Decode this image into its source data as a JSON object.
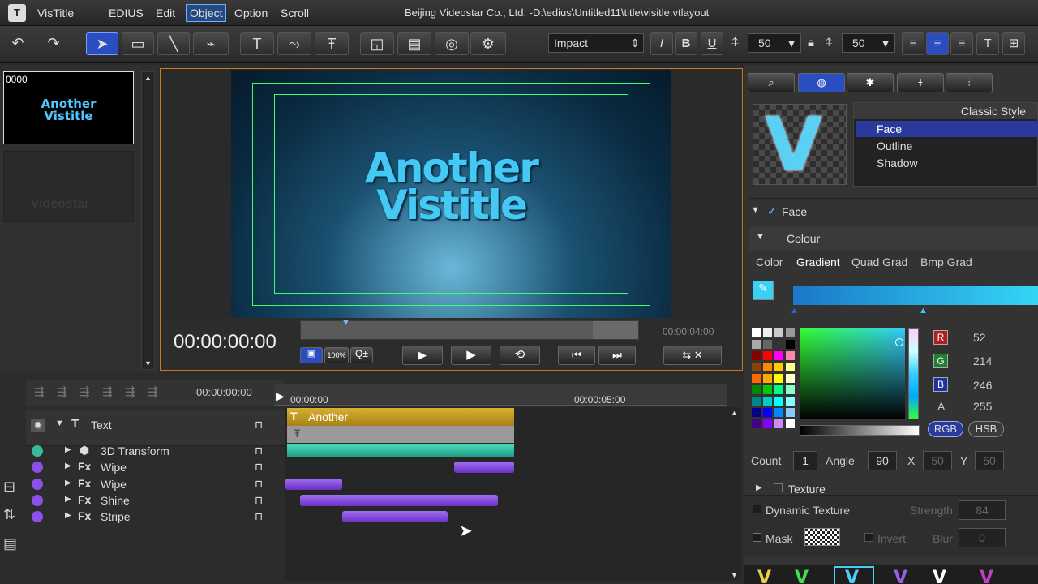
{
  "app": {
    "name": "VisTitle",
    "title": "Beijing Videostar Co., Ltd. -D:\\edius\\Untitled11\\title\\visitle.vtlayout"
  },
  "menu": [
    "EDIUS",
    "Edit",
    "Object",
    "Option",
    "Scroll"
  ],
  "toolbar": {
    "font": "Impact",
    "size1": "50",
    "size2": "50"
  },
  "thumbs": {
    "index": "0000",
    "line1": "Another",
    "line2": "Vistitle",
    "logo": "videostar"
  },
  "preview": {
    "line1": "Another",
    "line2": "Vistitle",
    "timecode": "00:00:00:00",
    "duration": "00:00:04:00",
    "zoom": "100%"
  },
  "timeline": {
    "cursor_time": "00:00:00:00",
    "ruler_start": "00:00:00",
    "ruler_mid": "00:00:05:00",
    "clip_label": "Another",
    "tracks": [
      {
        "name": "Text"
      },
      {
        "name": "3D Transform"
      },
      {
        "name": "Wipe"
      },
      {
        "name": "Wipe"
      },
      {
        "name": "Shine"
      },
      {
        "name": "Stripe"
      }
    ]
  },
  "style": {
    "header": "Classic Style",
    "items": [
      "Face",
      "Outline",
      "Shadow"
    ],
    "preview_letter": "V"
  },
  "face": {
    "section": "Face",
    "colour": "Colour",
    "tabs": [
      "Color",
      "Gradient",
      "Quad Grad",
      "Bmp Grad"
    ],
    "R": "52",
    "G": "214",
    "B": "246",
    "A": "255",
    "rgb": "RGB",
    "hsb": "HSB",
    "count_label": "Count",
    "count": "1",
    "angle_label": "Angle",
    "angle": "90",
    "x_label": "X",
    "x": "50",
    "y_label": "Y",
    "y": "50",
    "texture": "Texture"
  },
  "bottom": {
    "dynamic": "Dynamic Texture",
    "strength_label": "Strength",
    "strength": "84",
    "mask": "Mask",
    "invert": "Invert",
    "blur_label": "Blur",
    "blur": "0"
  },
  "colors": {
    "accent": "#34d6f6",
    "clip_gold": "#c8a02a",
    "fx_purple": "#7a40d8",
    "selected": "#2a3a9c"
  }
}
